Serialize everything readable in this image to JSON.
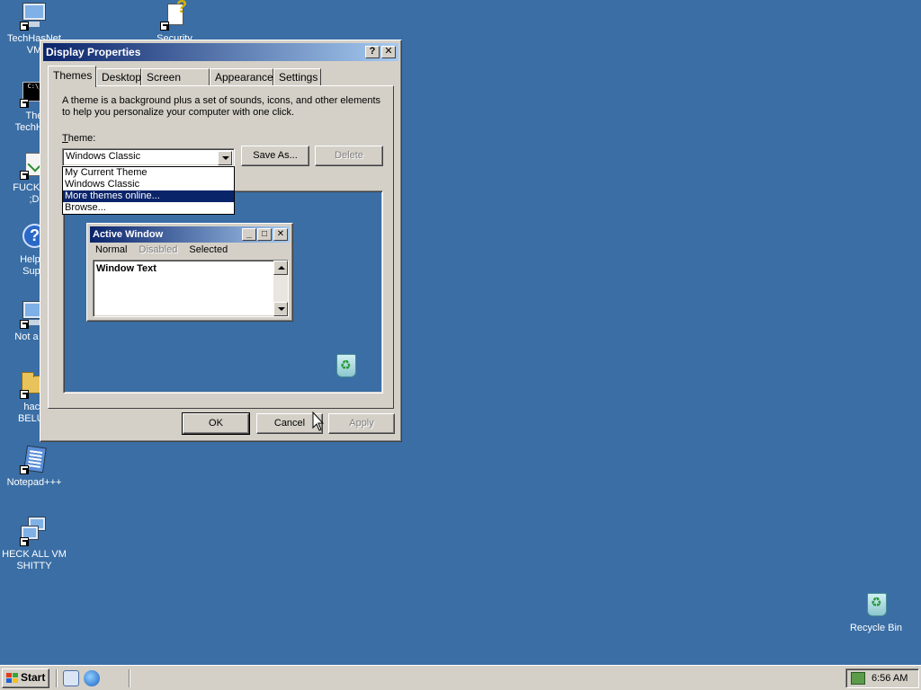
{
  "desktop": {
    "icons": [
      {
        "label": "TechHasNet\nVM",
        "icon": "monitor-icon"
      },
      {
        "label": "Security",
        "icon": "security-key-icon"
      },
      {
        "label": "The\nTechHas",
        "icon": "command-prompt-icon"
      },
      {
        "label": "FUCK TH\n;D",
        "icon": "document-icon"
      },
      {
        "label": "Help a\nSupp",
        "icon": "help-icon"
      },
      {
        "label": "Not a Co",
        "icon": "computer-icon"
      },
      {
        "label": "hack\nBELUS",
        "icon": "folder-icon"
      },
      {
        "label": "Notepad+++",
        "icon": "notepad-icon"
      },
      {
        "label": "HECK ALL VM\nSHITTY",
        "icon": "network-icon"
      },
      {
        "label": "Recycle Bin",
        "icon": "recycle-bin-icon"
      }
    ]
  },
  "dialog": {
    "title": "Display Properties",
    "help_btn": "?",
    "close_btn": "✕",
    "tabs": [
      "Themes",
      "Desktop",
      "Screen Saver",
      "Appearance",
      "Settings"
    ],
    "active_tab": "Themes",
    "description": "A theme is a background plus a set of sounds, icons, and other elements to help you personalize your computer with one click.",
    "theme_label": "Theme:",
    "theme_value": "Windows Classic",
    "dropdown_options": [
      "My Current Theme",
      "Windows Classic",
      "More themes online...",
      "Browse..."
    ],
    "dropdown_selected": "More themes online...",
    "save_as": "Save As...",
    "delete": "Delete",
    "ok": "OK",
    "cancel": "Cancel",
    "apply": "Apply"
  },
  "preview": {
    "window_title": "Active Window",
    "menu": [
      "Normal",
      "Disabled",
      "Selected"
    ],
    "window_text": "Window Text"
  },
  "taskbar": {
    "start": "Start",
    "clock": "6:56 AM"
  },
  "colors": {
    "desktop": "#3a6ea5",
    "title_active_start": "#0a246a",
    "title_active_end": "#a6caf0",
    "face": "#d4d0c8"
  }
}
